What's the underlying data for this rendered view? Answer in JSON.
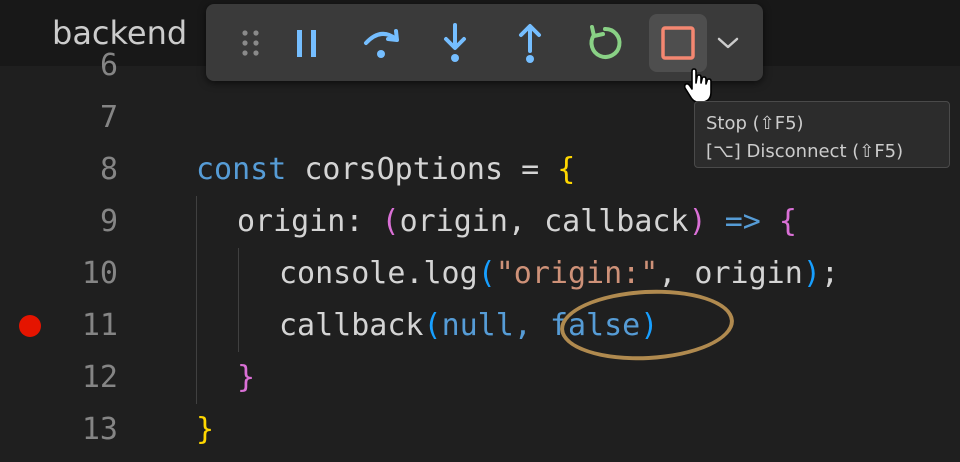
{
  "tab": {
    "title": "backend"
  },
  "toolbar": {
    "buttons": [
      {
        "name": "drag-handle",
        "icon": "grip-icon"
      },
      {
        "name": "pause-button",
        "icon": "pause-icon"
      },
      {
        "name": "step-over-button",
        "icon": "step-over-icon"
      },
      {
        "name": "step-into-button",
        "icon": "step-into-icon"
      },
      {
        "name": "step-out-button",
        "icon": "step-out-icon"
      },
      {
        "name": "restart-button",
        "icon": "restart-icon"
      },
      {
        "name": "stop-button",
        "icon": "stop-icon"
      },
      {
        "name": "more-button",
        "icon": "chevron-down-icon"
      }
    ],
    "colors": {
      "pause": "#75beff",
      "step": "#75beff",
      "restart": "#89d185",
      "stop": "#f48771"
    }
  },
  "tooltip": {
    "line1": "Stop (⇧F5)",
    "line2": "[⌥] Disconnect (⇧F5)"
  },
  "editor": {
    "lines": [
      {
        "num": "6"
      },
      {
        "num": "7"
      },
      {
        "num": "8",
        "t": [
          "const",
          "corsOptions",
          "=",
          "{"
        ]
      },
      {
        "num": "9",
        "t": [
          "origin:",
          "(",
          "origin,",
          "callback",
          ")",
          "=>",
          "{"
        ]
      },
      {
        "num": "10",
        "t": [
          "console.log",
          "(",
          "\"origin:\"",
          ", origin",
          ")",
          ";"
        ]
      },
      {
        "num": "11",
        "breakpoint": true,
        "t": [
          "callback",
          "(",
          "null,",
          "false",
          ")"
        ]
      },
      {
        "num": "12",
        "t": [
          "}"
        ]
      },
      {
        "num": "13",
        "t": [
          "}"
        ]
      }
    ]
  },
  "colors": {
    "keyword": "#569cd6",
    "string": "#ce9178",
    "bracket1": "#ffd700",
    "bracket2": "#da70d6",
    "bracket3": "#179fff",
    "breakpoint": "#e51400",
    "annotation": "#b08a4f"
  }
}
